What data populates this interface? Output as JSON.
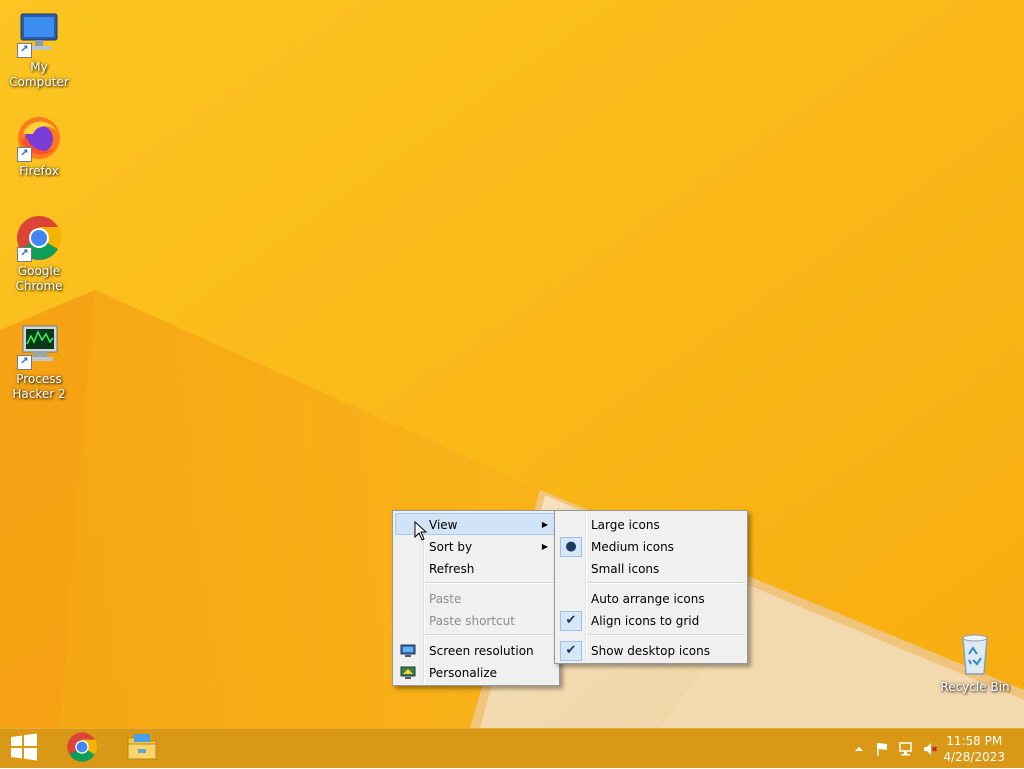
{
  "desktop": {
    "icons": [
      {
        "label": "My Computer",
        "icon": "computer-icon"
      },
      {
        "label": "Firefox",
        "icon": "firefox-icon"
      },
      {
        "label": "Google Chrome",
        "icon": "chrome-icon"
      },
      {
        "label": "Process Hacker 2",
        "icon": "process-hacker-icon"
      },
      {
        "label": "Recycle Bin",
        "icon": "recycle-bin-icon"
      }
    ]
  },
  "context_menu": {
    "items": {
      "view": "View",
      "sort_by": "Sort by",
      "refresh": "Refresh",
      "paste": "Paste",
      "paste_shortcut": "Paste shortcut",
      "screen_resolution": "Screen resolution",
      "personalize": "Personalize"
    }
  },
  "view_submenu": {
    "items": {
      "large_icons": "Large icons",
      "medium_icons": "Medium icons",
      "small_icons": "Small icons",
      "auto_arrange": "Auto arrange icons",
      "align_grid": "Align icons to grid",
      "show_desktop_icons": "Show desktop icons"
    },
    "selected_size": "Medium icons",
    "auto_arrange_checked": false,
    "align_grid_checked": true,
    "show_desktop_icons_checked": true
  },
  "taskbar": {
    "clock_time": "11:58 PM",
    "clock_date": "4/28/2023",
    "pinned": [
      "windows-start-icon",
      "chrome-icon",
      "file-explorer-icon"
    ],
    "tray": [
      "tray-overflow-icon",
      "action-center-flag-icon",
      "network-icon",
      "volume-muted-icon"
    ]
  },
  "colors": {
    "wallpaper": "#f9b414",
    "taskbar": "#d99916",
    "menu_highlight": "#d1e3f6"
  }
}
